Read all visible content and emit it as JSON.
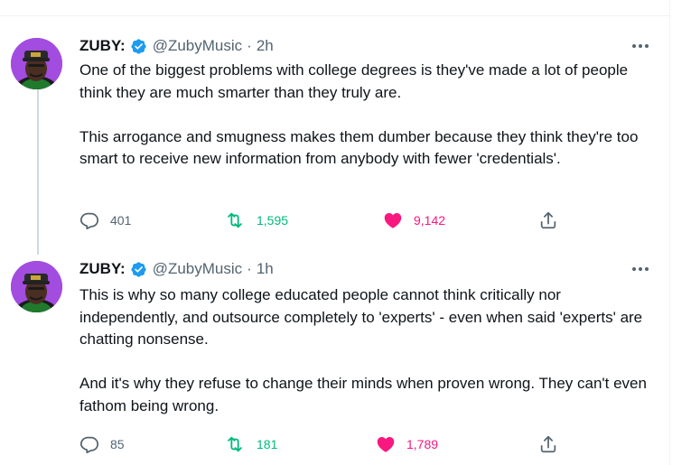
{
  "colors": {
    "text": "#0f1419",
    "secondary": "#536471",
    "verified": "#1d9bf0",
    "retweet_active": "#00ba7c",
    "like_active": "#f91880",
    "divider": "#eff3f4",
    "thread_line": "#cfd9de",
    "avatar_bg": "#a24ce0"
  },
  "tweets": [
    {
      "name": "ZUBY:",
      "handle": "@ZubyMusic",
      "separator": "·",
      "time": "2h",
      "paragraphs": [
        "One of the biggest problems with college degrees is they've made a lot of people think they are much smarter than they truly are.",
        "This arrogance and smugness makes them dumber because they think they're too smart to receive new information from anybody with fewer 'credentials'."
      ],
      "replies": "401",
      "retweets": "1,595",
      "likes": "9,142",
      "icons": [
        "avatar-image",
        "verified-badge-icon",
        "more-options-icon",
        "reply-icon",
        "retweet-icon",
        "like-heart-icon",
        "share-icon"
      ]
    },
    {
      "name": "ZUBY:",
      "handle": "@ZubyMusic",
      "separator": "·",
      "time": "1h",
      "paragraphs": [
        "This is why so many college educated people cannot think critically nor independently, and outsource completely to 'experts' - even when said 'experts' are chatting nonsense.",
        "And it's why they refuse to change their minds when proven wrong. They can't even fathom being wrong."
      ],
      "replies": "85",
      "retweets": "181",
      "likes": "1,789",
      "icons": [
        "avatar-image",
        "verified-badge-icon",
        "more-options-icon",
        "reply-icon",
        "retweet-icon",
        "like-heart-icon",
        "share-icon"
      ]
    }
  ]
}
